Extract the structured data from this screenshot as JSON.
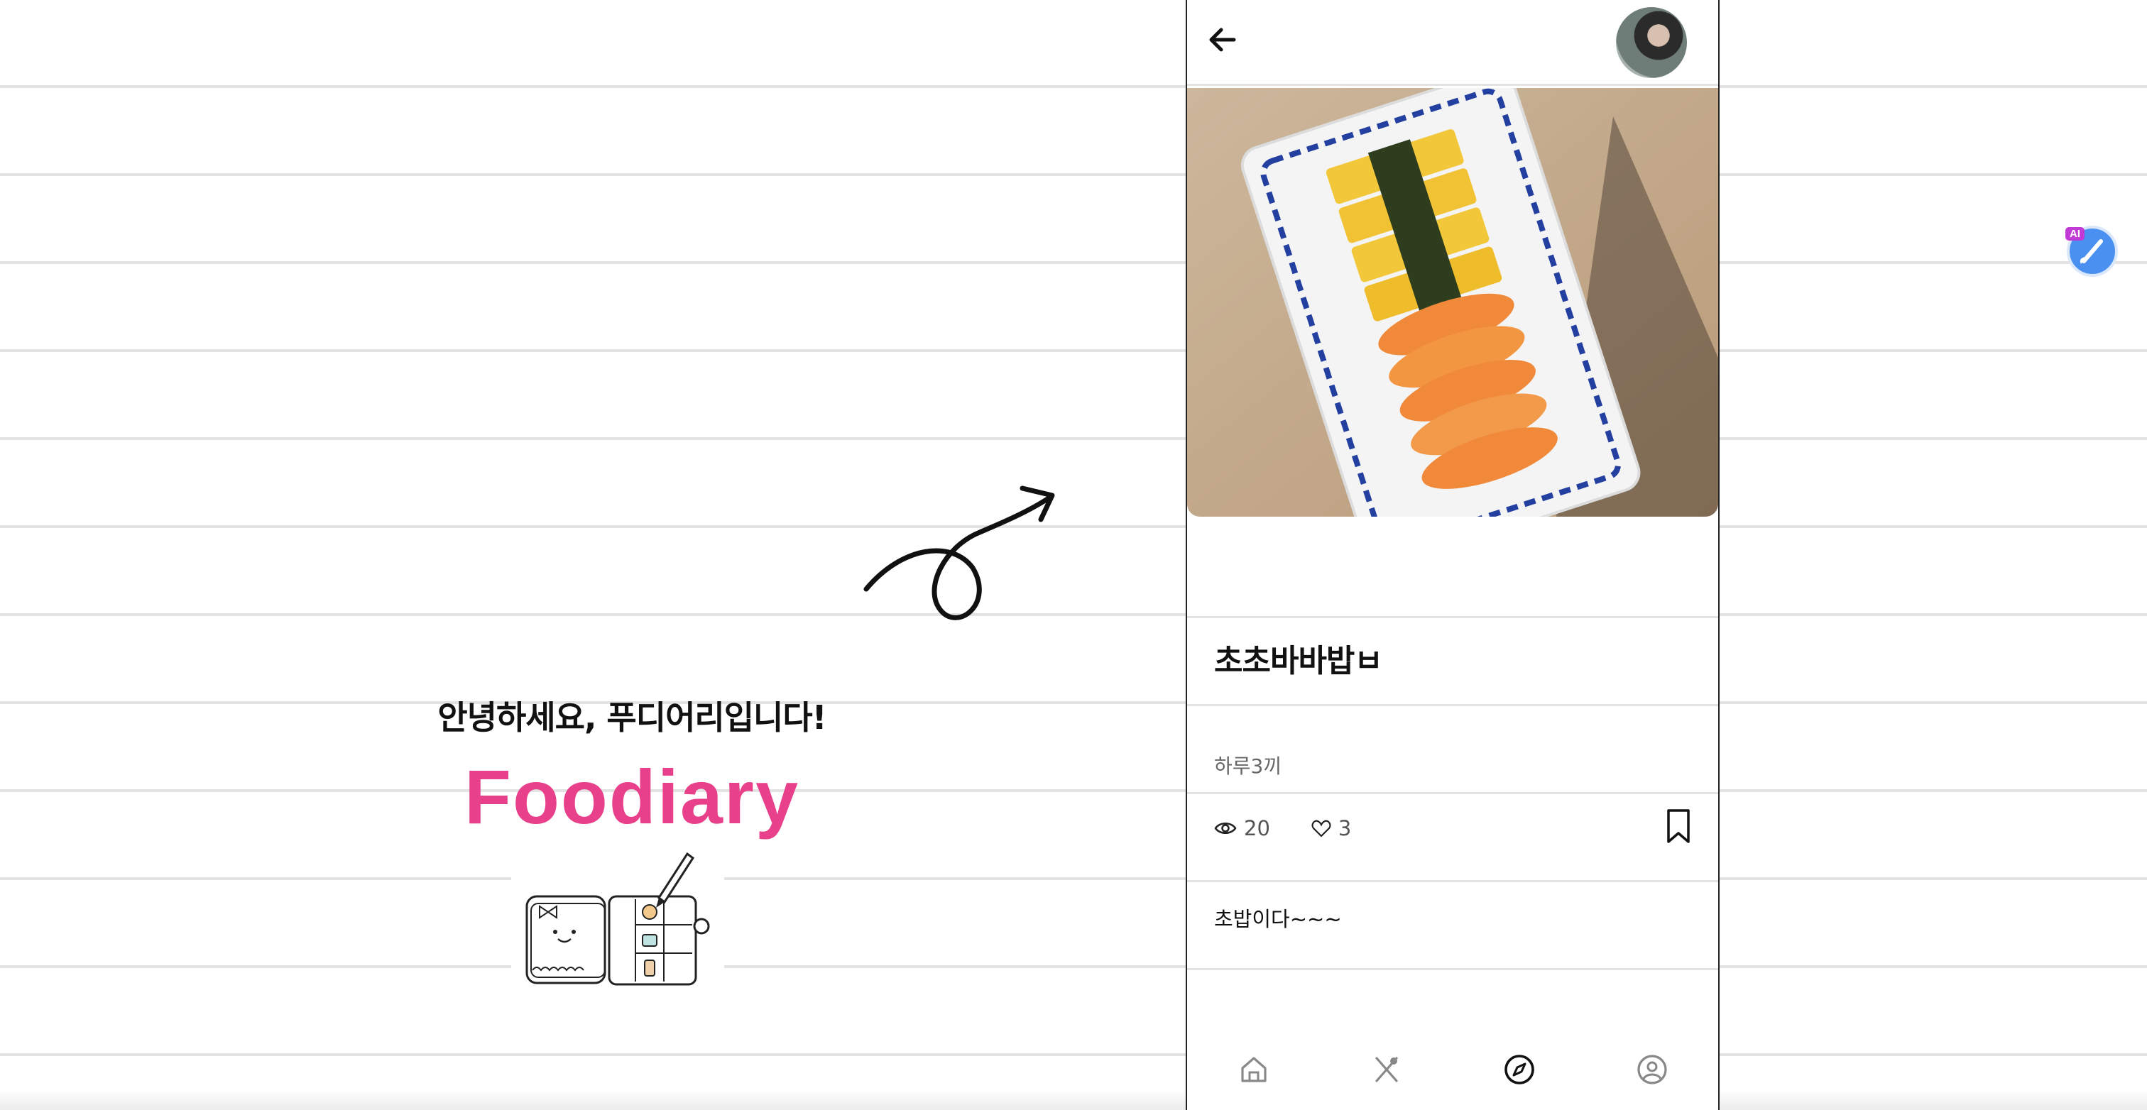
{
  "landing": {
    "greeting": "안녕하세요, 푸디어리입니다!",
    "brand": "Foodiary"
  },
  "post": {
    "title": "초초바바밥ㅂ",
    "category": "하루3끼",
    "views": "20",
    "likes": "3",
    "body": "초밥이다~~~"
  },
  "nav": {
    "items": [
      "home-icon",
      "utensils-icon",
      "compass-icon",
      "profile-icon"
    ],
    "active": "compass-icon"
  },
  "ai_widget": {
    "badge": "AI"
  },
  "colors": {
    "brand": "#e8408a",
    "divider": "#e3e3e3",
    "text": "#111111"
  }
}
